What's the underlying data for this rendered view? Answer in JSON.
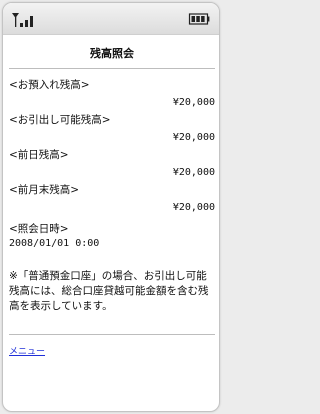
{
  "status": {
    "signal_icon": "signal-strength-icon",
    "battery_icon": "battery-icon"
  },
  "page": {
    "title": "残高照会"
  },
  "balances": [
    {
      "label": "<お預入れ残高>",
      "value": "¥20,000"
    },
    {
      "label": "<お引出し可能残高>",
      "value": "¥20,000"
    },
    {
      "label": "<前日残高>",
      "value": "¥20,000"
    },
    {
      "label": "<前月末残高>",
      "value": "¥20,000"
    }
  ],
  "inquiry": {
    "label": "<照会日時>",
    "value": "2008/01/01 0:00"
  },
  "note": "※「普通預金口座」の場合、お引出し可能残高には、総合口座貸越可能金額を含む残高を表示しています。",
  "footer": {
    "menu_link": "メニュー"
  }
}
